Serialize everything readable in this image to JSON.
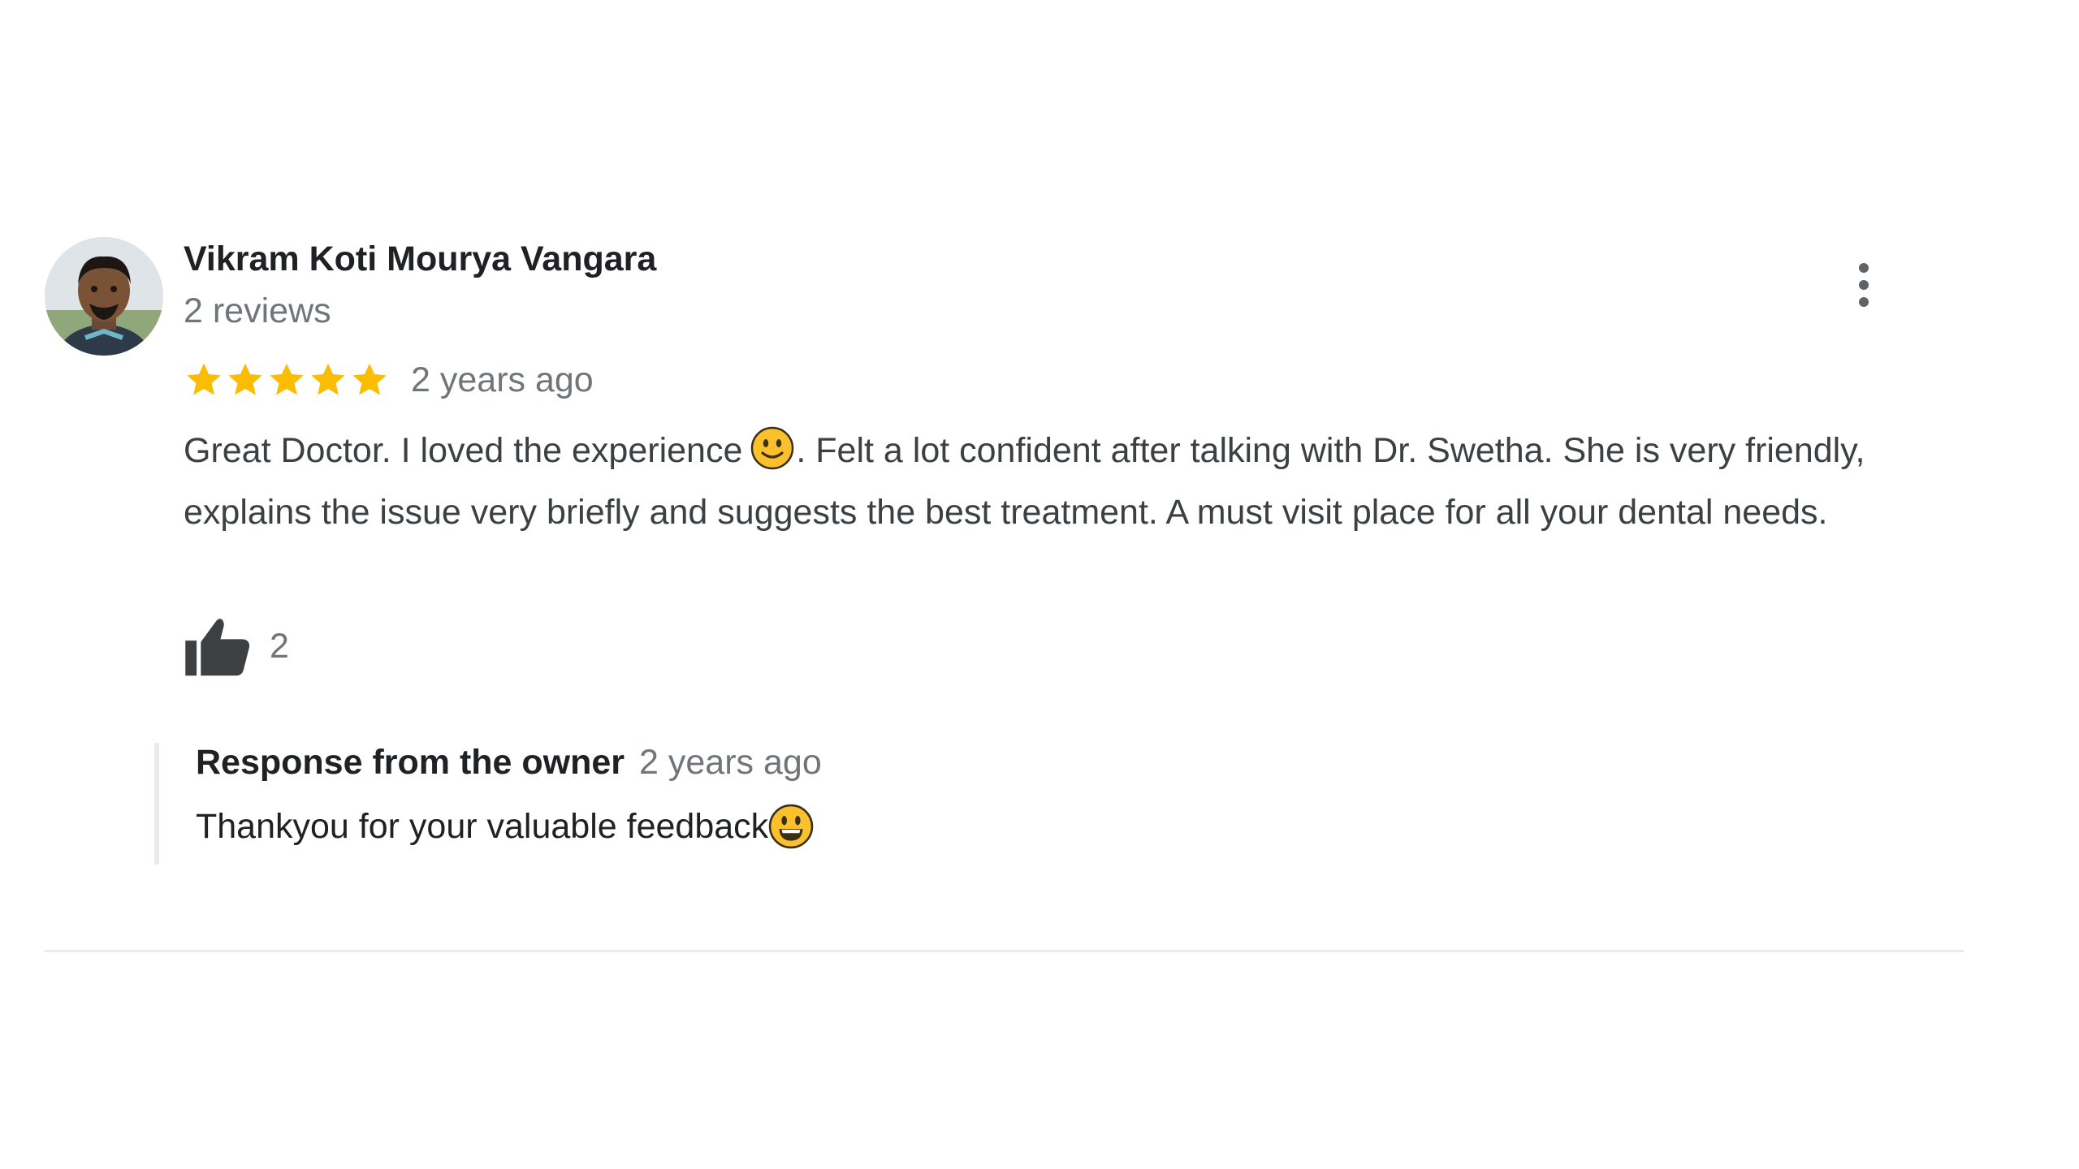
{
  "review": {
    "author": {
      "name": "Vikram Koti Mourya Vangara",
      "review_count": "2 reviews",
      "avatar_icon": "profile-photo"
    },
    "rating": 5,
    "max_rating": 5,
    "time_ago": "2 years ago",
    "text_part1": "Great Doctor. I loved the experience",
    "text_emoji": "slightly-smiling-face",
    "text_part2": ". Felt a lot confident after talking with Dr. Swetha. She is very friendly, explains the issue very briefly and suggests the best treatment. A must visit place for all your dental needs.",
    "likes": "2",
    "more_icon": "more-vertical-icon",
    "like_icon": "thumbs-up-icon"
  },
  "owner_response": {
    "title": "Response from the owner",
    "time_ago": "2 years ago",
    "text": "Thankyou for your valuable feedback",
    "emoji": "grinning-face"
  },
  "colors": {
    "star": "#fbbc04",
    "secondary_text": "#70757a",
    "primary_text": "#202124",
    "divider": "#e8eaed",
    "emoji": "#fbc02d"
  }
}
